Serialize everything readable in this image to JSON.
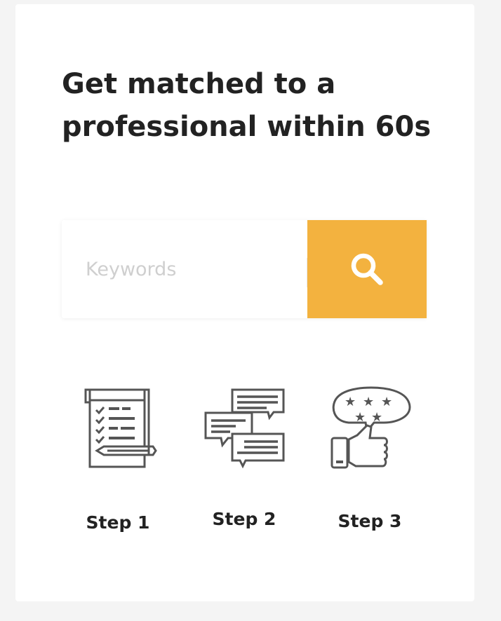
{
  "hero": {
    "headline_line1": "Get matched to a",
    "headline_line2": "professional within 60s"
  },
  "search": {
    "placeholder": "Keywords",
    "value": "",
    "button_icon": "search-icon",
    "button_color": "#f3b23f"
  },
  "steps": [
    {
      "label": "Step 1",
      "icon": "checklist-icon"
    },
    {
      "label": "Step 2",
      "icon": "chat-bubbles-icon"
    },
    {
      "label": "Step 3",
      "icon": "rating-thumbs-up-icon"
    }
  ]
}
